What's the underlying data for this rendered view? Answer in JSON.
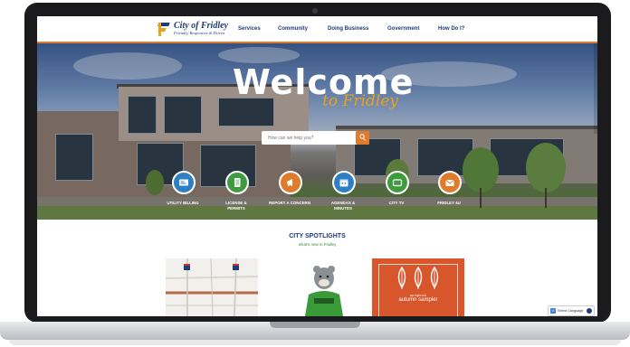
{
  "site": {
    "logo_name": "City of Fridley",
    "logo_tagline": "Friendly, Responsive & Driven"
  },
  "nav": {
    "items": [
      "Services",
      "Community",
      "Doing Business",
      "Government",
      "How Do I?"
    ]
  },
  "hero": {
    "welcome": "Welcome",
    "subtitle": "to Fridley"
  },
  "search": {
    "placeholder": "How can we help you?"
  },
  "quick_links": [
    {
      "label": "UTILITY BILLING",
      "icon": "bill-icon",
      "color": "#2f7fc4"
    },
    {
      "label": "LICENSE & PERMITS",
      "icon": "document-icon",
      "color": "#3f9b3f"
    },
    {
      "label": "REPORT A CONCERN",
      "icon": "megaphone-icon",
      "color": "#e07b2b"
    },
    {
      "label": "AGENDAS & MINUTES",
      "icon": "calendar-icon",
      "color": "#2f7fc4"
    },
    {
      "label": "CITY TV",
      "icon": "tv-icon",
      "color": "#3f9b3f"
    },
    {
      "label": "FRIDLEY 4U",
      "icon": "mail-icon",
      "color": "#e07b2b"
    }
  ],
  "spotlights": {
    "title": "CITY SPOTLIGHTS",
    "subtitle": "what's new in Fridley",
    "autumn_small": "springbrook",
    "autumn_title": "autumn sampler"
  },
  "language": {
    "label": "Select Language"
  },
  "colors": {
    "brand_blue": "#1f3b7a",
    "accent_orange": "#e07b2b",
    "accent_gold": "#e8a21d",
    "green": "#3a8a3a"
  }
}
